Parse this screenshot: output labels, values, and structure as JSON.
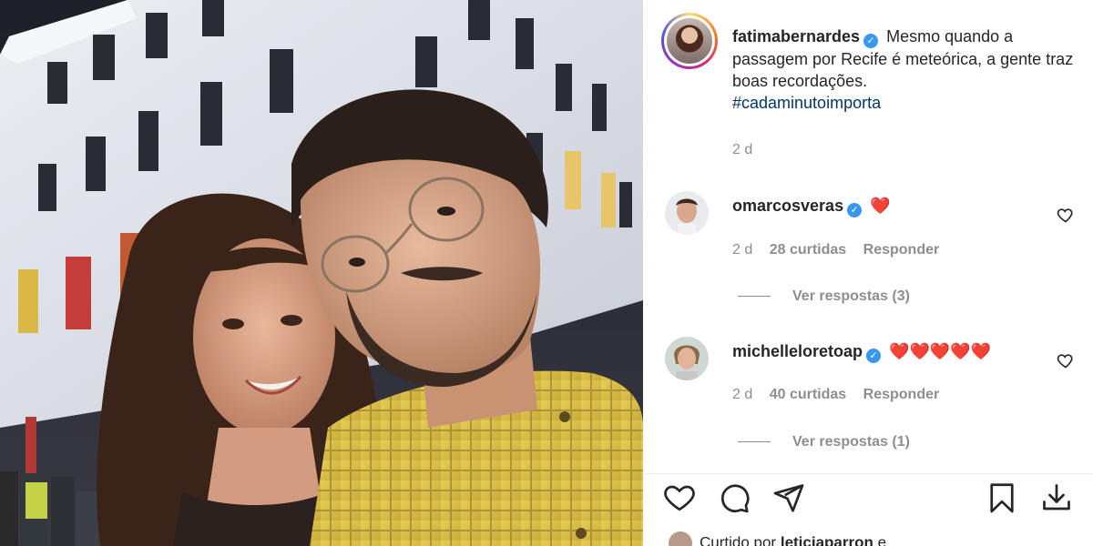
{
  "post": {
    "author": "fatimabernardes",
    "caption": "Mesmo quando a passagem por Recife é meteórica, a gente traz boas recordações.",
    "hashtag": "#cadaminutoimporta",
    "time": "2 d"
  },
  "comments": [
    {
      "user": "omarcosveras",
      "text": "❤️",
      "time": "2 d",
      "likes": "28 curtidas",
      "reply": "Responder",
      "view_replies": "Ver respostas (3)"
    },
    {
      "user": "michelleloretoap",
      "text": "❤️❤️❤️❤️❤️",
      "time": "2 d",
      "likes": "40 curtidas",
      "reply": "Responder",
      "view_replies": "Ver respostas (1)"
    }
  ],
  "liked_by": {
    "prefix": "Curtido por",
    "user": "leticiaparron",
    "suffix": "e"
  },
  "icons": {
    "like": "heart-icon",
    "comment": "comment-icon",
    "share": "send-icon",
    "save": "bookmark-icon",
    "download": "download-icon"
  },
  "colors": {
    "verified": "#3897f0",
    "hashtag": "#00376b",
    "secondary_text": "#8e8e8e",
    "heart": "#ed1c24"
  }
}
